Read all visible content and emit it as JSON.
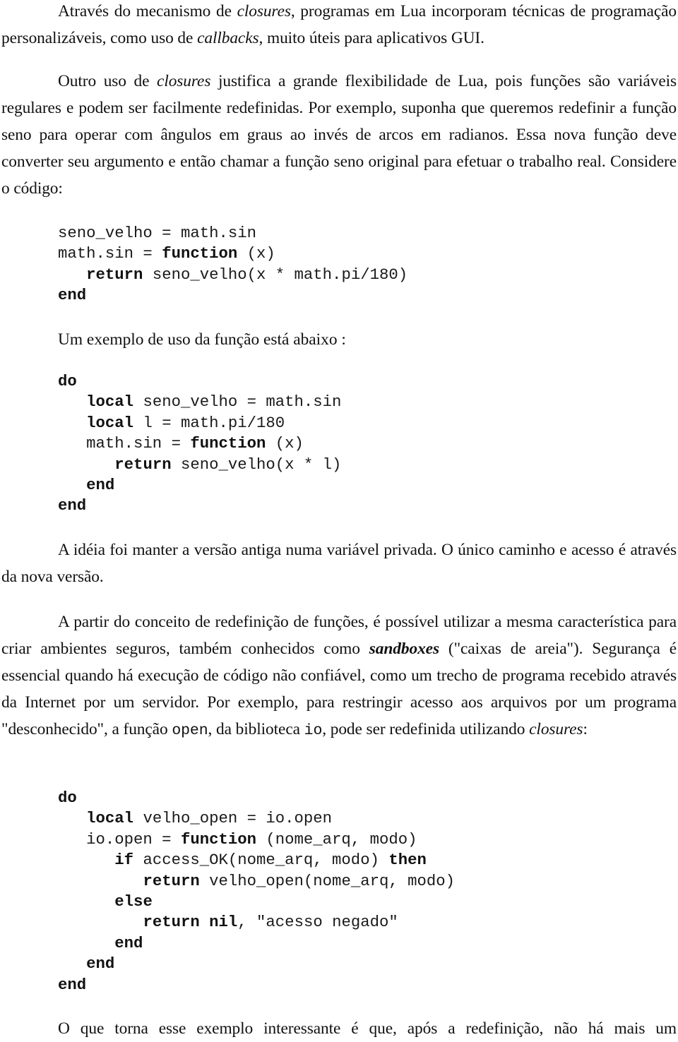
{
  "document": {
    "paragraphs": {
      "p1": {
        "parts": [
          {
            "t": "Através do mecanismo de "
          },
          {
            "t": "closures",
            "style": "italic"
          },
          {
            "t": ", programas em Lua incorporam técnicas de programação personalizáveis, como uso de "
          },
          {
            "t": "callbacks",
            "style": "italic"
          },
          {
            "t": ", muito úteis para aplicativos GUI."
          }
        ]
      },
      "p2": {
        "parts": [
          {
            "t": "Outro uso de "
          },
          {
            "t": "closures",
            "style": "italic"
          },
          {
            "t": " justifica a grande flexibilidade de Lua, pois funções são variáveis regulares e podem ser facilmente redefinidas. Por exemplo, suponha que queremos redefinir a função seno para operar com ângulos em graus ao invés de arcos em radianos. Essa nova função deve converter seu argumento e então chamar a função seno original para efetuar o trabalho real. Considere o código:"
          }
        ]
      },
      "caption1": "Um exemplo de uso da função está abaixo :",
      "p3": {
        "parts": [
          {
            "t": "A idéia foi manter a versão antiga numa variável privada. O único caminho e acesso é através da nova versão."
          }
        ]
      },
      "p4": {
        "parts": [
          {
            "t": "A partir do conceito de redefinição de funções, é possível utilizar a mesma característica para criar ambientes seguros, também conhecidos como "
          },
          {
            "t": "sandboxes",
            "style": "bold-italic"
          },
          {
            "t": " (\"caixas de areia\"). Segurança é essencial quando há execução de código não confiável, como um trecho de programa recebido através da Internet por um servidor. Por exemplo, para restringir acesso aos arquivos por um programa \"desconhecido\", a função "
          },
          {
            "t": "open",
            "style": "code"
          },
          {
            "t": ", da biblioteca "
          },
          {
            "t": "io",
            "style": "code"
          },
          {
            "t": ", pode ser redefinida utilizando "
          },
          {
            "t": "closures",
            "style": "italic"
          },
          {
            "t": ":"
          }
        ]
      },
      "p5": {
        "parts": [
          {
            "t": "O que torna esse exemplo interessante é que, após a redefinição, não há mais um"
          }
        ]
      }
    },
    "code_blocks": {
      "code1": [
        [
          {
            "t": "seno_velho = math.sin"
          }
        ],
        [
          {
            "t": "math.sin = "
          },
          {
            "t": "function",
            "kw": true
          },
          {
            "t": " (x)"
          }
        ],
        [
          {
            "t": "   "
          },
          {
            "t": "return",
            "kw": true
          },
          {
            "t": " seno_velho(x * math.pi/180)"
          }
        ],
        [
          {
            "t": "end",
            "kw": true
          }
        ]
      ],
      "code2": [
        [
          {
            "t": "do",
            "kw": true
          }
        ],
        [
          {
            "t": "   "
          },
          {
            "t": "local",
            "kw": true
          },
          {
            "t": " seno_velho = math.sin"
          }
        ],
        [
          {
            "t": "   "
          },
          {
            "t": "local",
            "kw": true
          },
          {
            "t": " l = math.pi/180"
          }
        ],
        [
          {
            "t": "   math.sin = "
          },
          {
            "t": "function",
            "kw": true
          },
          {
            "t": " (x)"
          }
        ],
        [
          {
            "t": "      "
          },
          {
            "t": "return",
            "kw": true
          },
          {
            "t": " seno_velho(x * l)"
          }
        ],
        [
          {
            "t": "   "
          },
          {
            "t": "end",
            "kw": true
          }
        ],
        [
          {
            "t": "end",
            "kw": true
          }
        ]
      ],
      "code3": [
        [
          {
            "t": "do",
            "kw": true
          }
        ],
        [
          {
            "t": "   "
          },
          {
            "t": "local",
            "kw": true
          },
          {
            "t": " velho_open = io.open"
          }
        ],
        [
          {
            "t": "   io.open = "
          },
          {
            "t": "function",
            "kw": true
          },
          {
            "t": " (nome_arq, modo)"
          }
        ],
        [
          {
            "t": "      "
          },
          {
            "t": "if",
            "kw": true
          },
          {
            "t": " access_OK(nome_arq, modo) "
          },
          {
            "t": "then",
            "kw": true
          }
        ],
        [
          {
            "t": "         "
          },
          {
            "t": "return",
            "kw": true
          },
          {
            "t": " velho_open(nome_arq, modo)"
          }
        ],
        [
          {
            "t": "      "
          },
          {
            "t": "else",
            "kw": true
          }
        ],
        [
          {
            "t": "         "
          },
          {
            "t": "return",
            "kw": true
          },
          {
            "t": " "
          },
          {
            "t": "nil",
            "kw": true
          },
          {
            "t": ", \"acesso negado\""
          }
        ],
        [
          {
            "t": "      "
          },
          {
            "t": "end",
            "kw": true
          }
        ],
        [
          {
            "t": "   "
          },
          {
            "t": "end",
            "kw": true
          }
        ],
        [
          {
            "t": "end",
            "kw": true
          }
        ]
      ]
    }
  }
}
